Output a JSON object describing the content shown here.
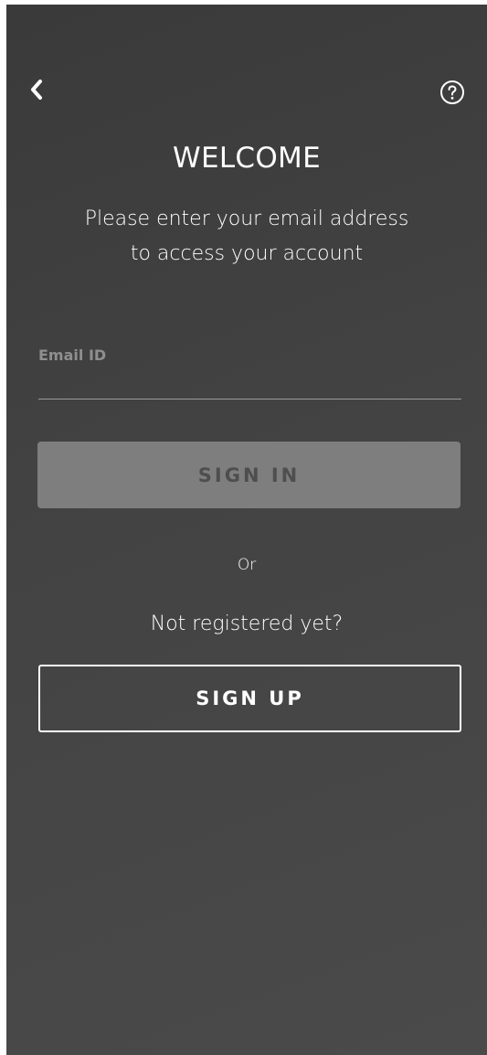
{
  "header": {
    "back_icon": "chevron-left-icon",
    "help_icon": "question-circle-icon"
  },
  "welcome": {
    "title": "WELCOME",
    "subtitle_line1": "Please enter your email address",
    "subtitle_line2": "to access your account"
  },
  "form": {
    "email_label": "Email ID",
    "email_value": "",
    "signin_label": "SIGN IN"
  },
  "alt": {
    "or_text": "Or",
    "not_registered": "Not registered yet?",
    "signup_label": "SIGN UP"
  },
  "colors": {
    "background": "#434343",
    "signin_button_bg": "#7e7e7e",
    "signin_button_text": "#4e4e4e",
    "label_gray": "#8f8f8f",
    "text": "#ffffff"
  }
}
